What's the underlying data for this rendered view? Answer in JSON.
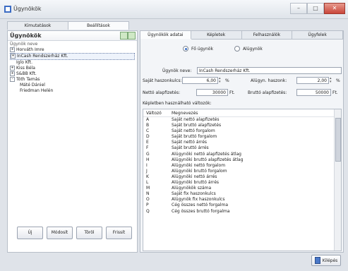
{
  "window": {
    "title": "Ügynökök"
  },
  "top_tabs": [
    "Kimutatások",
    "Beállítások"
  ],
  "left": {
    "header": "Ügynökök",
    "column": "Ügynök neve",
    "tree": [
      {
        "label": "Horváth Imre",
        "exp": "+",
        "level": 0
      },
      {
        "label": "InCash Rendszerház Kft.",
        "exp": "+",
        "level": 0,
        "selected": true
      },
      {
        "label": "Iglo Kft.",
        "exp": "",
        "level": 1
      },
      {
        "label": "Kiss Béla",
        "exp": "+",
        "level": 0
      },
      {
        "label": "S&BB Kft.",
        "exp": "+",
        "level": 0
      },
      {
        "label": "Tóth Tamás",
        "exp": "-",
        "level": 0
      },
      {
        "label": "Máté Dániel",
        "exp": "",
        "level": 2
      },
      {
        "label": "Friedman Helén",
        "exp": "",
        "level": 2
      }
    ],
    "buttons": [
      "Új",
      "Módosít",
      "Töröl",
      "Frissít"
    ]
  },
  "right": {
    "tabs": [
      "Ügynökök adatai",
      "Képletek",
      "Felhasználók",
      "Ügyfelek"
    ],
    "radios": [
      {
        "label": "Fő ügynök",
        "checked": true
      },
      {
        "label": "Alügynök",
        "checked": false
      }
    ],
    "name_label": "Ügynök neve:",
    "name_value": "InCash Rendszerház Kft.",
    "own_share_label": "Saját haszonkulcs:",
    "own_share_value": "6,00",
    "pct": "%",
    "sub_share_label": "Alügyn. haszonk:",
    "sub_share_value": "2,00",
    "net_label": "Nettó alapfizetés:",
    "net_value": "30000",
    "ft": "Ft.",
    "gross_label": "Bruttó alapfizetés:",
    "gross_value": "50000",
    "formula_label": "Képletben használható változók:",
    "var_header": [
      "Változó",
      "Megnevezés"
    ],
    "variables": [
      [
        "A",
        "Saját nettó alapfizetés"
      ],
      [
        "B",
        "Saját bruttó alapfizetés"
      ],
      [
        "C",
        "Saját nettó forgalom"
      ],
      [
        "D",
        "Saját bruttó forgalom"
      ],
      [
        "E",
        "Saját nettó árrés"
      ],
      [
        "F",
        "Saját bruttó árrés"
      ],
      [
        "G",
        "Alügynöki nettó alapfizetés átlag"
      ],
      [
        "H",
        "Alügynöki bruttó alapfizetés átlag"
      ],
      [
        "I",
        "Alügynöki nettó forgalom"
      ],
      [
        "J",
        "Alügynöki bruttó forgalom"
      ],
      [
        "K",
        "Alügynöki nettó árrés"
      ],
      [
        "L",
        "Alügynöki bruttó árrés"
      ],
      [
        "M",
        "Alügynökök száma"
      ],
      [
        "N",
        "Saját fix haszonkulcs"
      ],
      [
        "O",
        "Alügynök fix haszonkulcs"
      ],
      [
        "P",
        "Cég összes nettó forgalma"
      ],
      [
        "Q",
        "Cég összes bruttó forgalma"
      ]
    ]
  },
  "exit_button": "Kilépés"
}
